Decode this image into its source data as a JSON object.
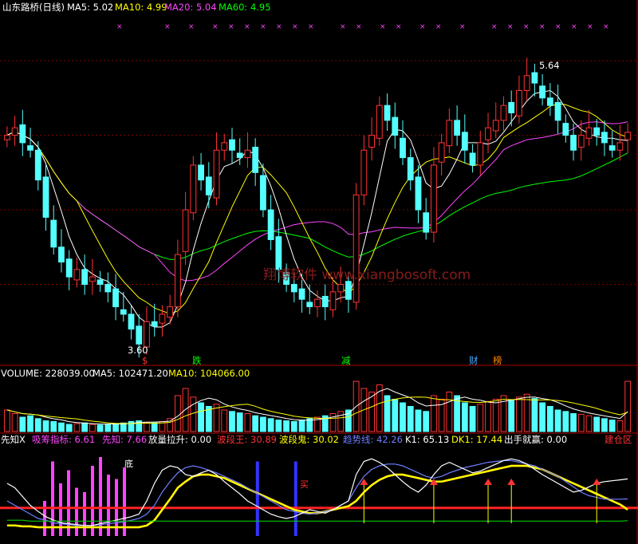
{
  "header": {
    "title": "山东路桥(日线)",
    "ma": [
      {
        "label": "MA5: 5.02",
        "color": "#ffffff"
      },
      {
        "label": "MA10: 4.99",
        "color": "#ffff00"
      },
      {
        "label": "MA20: 5.04",
        "color": "#ff44ff"
      },
      {
        "label": "MA60: 4.95",
        "color": "#00ff00"
      }
    ]
  },
  "volume_header": [
    {
      "label": "VOLUME: 228039.00",
      "color": "#ffffff"
    },
    {
      "label": "MA5: 102471.20",
      "color": "#ffffff"
    },
    {
      "label": "MA10: 104066.00",
      "color": "#ffff00"
    }
  ],
  "indicator_header": [
    {
      "label": "先知X",
      "color": "#ffffff"
    },
    {
      "label": "吸筹指标: 6.61",
      "color": "#ff44ff"
    },
    {
      "label": "先知: 7.66",
      "color": "#ff44ff"
    },
    {
      "label": "放量拉升: 0.00",
      "color": "#ffffff"
    },
    {
      "label": "波段王: 30.89",
      "color": "#ff3333"
    },
    {
      "label": "波段鬼: 30.02",
      "color": "#ffff00"
    },
    {
      "label": "趋势线: 42.26",
      "color": "#6f7fff"
    },
    {
      "label": "K1: 65.13",
      "color": "#ffffff"
    },
    {
      "label": "DK1: 17.44",
      "color": "#ffff00"
    },
    {
      "label": "出手就赢: 0.00",
      "color": "#ffffff"
    },
    {
      "label": "建仓区",
      "color": "#ff3333"
    }
  ],
  "annotations": {
    "high_label": "5.64",
    "low_label": "3.60",
    "watermark": "翔博软件 www.xiangbosoft.com",
    "signals": [
      {
        "text": "跌",
        "color": "#00ff00"
      },
      {
        "text": "减",
        "color": "#00ff00"
      },
      {
        "text": "财",
        "color": "#44aaff"
      },
      {
        "text": "榜",
        "color": "#ff8800"
      },
      {
        "text": "$",
        "color": "#ff3333"
      }
    ],
    "buy_marker": "买",
    "low_marker": "底"
  },
  "colors": {
    "up": "#ff3333",
    "down": "#54ffff",
    "ma5": "#ffffff",
    "ma10": "#ffff00",
    "ma20": "#ff44ff",
    "ma60": "#00ff00",
    "axis": "#b00000"
  },
  "chart_data": [
    {
      "type": "candlestick",
      "title": "山东路桥(日线)",
      "ylim": [
        3.5,
        5.8
      ],
      "high": 5.64,
      "low": 3.6,
      "close": [
        5.0,
        5.05,
        4.95,
        4.9,
        4.7,
        4.45,
        4.25,
        4.15,
        4.05,
        4.1,
        4.0,
        4.05,
        4.0,
        3.95,
        3.85,
        3.8,
        3.7,
        3.6,
        3.75,
        3.72,
        3.8,
        3.85,
        4.2,
        4.5,
        4.8,
        4.7,
        4.6,
        4.9,
        4.95,
        4.9,
        4.85,
        4.9,
        4.75,
        4.5,
        4.3,
        4.1,
        4.0,
        3.95,
        3.9,
        3.85,
        3.9,
        3.85,
        3.95,
        4.0,
        3.9,
        4.6,
        4.9,
        5.0,
        5.2,
        5.1,
        5.0,
        4.85,
        4.7,
        4.5,
        4.35,
        4.8,
        4.95,
        5.1,
        5.0,
        4.9,
        4.8,
        4.95,
        5.05,
        5.1,
        5.2,
        5.15,
        5.3,
        5.4,
        5.35,
        5.25,
        5.2,
        5.1,
        5.0,
        4.9,
        5.0,
        5.05,
        5.0,
        4.95,
        4.9,
        4.95,
        5.02
      ],
      "ma5": 5.02,
      "ma10": 4.99,
      "ma20": 5.04,
      "ma60": 4.95
    },
    {
      "type": "bar",
      "title": "VOLUME",
      "values": [
        30,
        25,
        20,
        22,
        18,
        15,
        14,
        12,
        10,
        11,
        12,
        10,
        9,
        10,
        11,
        12,
        14,
        15,
        13,
        12,
        14,
        18,
        50,
        60,
        48,
        40,
        35,
        38,
        30,
        28,
        26,
        25,
        22,
        20,
        18,
        16,
        15,
        14,
        16,
        18,
        20,
        22,
        25,
        28,
        30,
        70,
        60,
        55,
        65,
        50,
        45,
        40,
        35,
        30,
        28,
        50,
        45,
        55,
        50,
        40,
        35,
        38,
        42,
        45,
        50,
        44,
        48,
        52,
        46,
        40,
        35,
        30,
        28,
        25,
        24,
        22,
        20,
        18,
        16,
        15,
        70
      ],
      "volume": 228039.0,
      "ma5": 102471.2,
      "ma10": 104066.0
    },
    {
      "type": "line",
      "title": "先知X",
      "series": [
        {
          "name": "波段王",
          "values": [
            12,
            12,
            11,
            11,
            10,
            10,
            10,
            10,
            10,
            10,
            10,
            10,
            10,
            10,
            10,
            10,
            10,
            10,
            12,
            18,
            30,
            42,
            55,
            62,
            68,
            70,
            70,
            68,
            66,
            62,
            58,
            54,
            50,
            46,
            42,
            38,
            34,
            30,
            28,
            26,
            26,
            28,
            30,
            32,
            34,
            40,
            50,
            58,
            64,
            68,
            70,
            70,
            68,
            66,
            64,
            62,
            62,
            64,
            66,
            68,
            70,
            72,
            74,
            76,
            78,
            80,
            80,
            80,
            78,
            76,
            72,
            68,
            64,
            60,
            56,
            52,
            48,
            44,
            40,
            36,
            30.89
          ]
        },
        {
          "name": "波段鬼",
          "values": [
            12,
            12,
            11,
            11,
            10,
            10,
            10,
            10,
            10,
            10,
            10,
            10,
            10,
            10,
            10,
            10,
            10,
            10,
            12,
            18,
            30,
            42,
            55,
            62,
            68,
            70,
            70,
            68,
            66,
            62,
            58,
            54,
            50,
            46,
            42,
            38,
            34,
            30,
            28,
            26,
            26,
            28,
            30,
            32,
            34,
            40,
            50,
            58,
            64,
            68,
            70,
            70,
            68,
            66,
            64,
            62,
            62,
            64,
            66,
            68,
            70,
            72,
            74,
            76,
            78,
            80,
            80,
            80,
            78,
            76,
            72,
            68,
            64,
            60,
            56,
            52,
            48,
            44,
            40,
            36,
            30.02
          ]
        },
        {
          "name": "趋势线",
          "values": [
            40,
            35,
            30,
            25,
            20,
            18,
            15,
            14,
            13,
            12,
            12,
            12,
            13,
            14,
            15,
            16,
            18,
            20,
            25,
            35,
            50,
            62,
            72,
            78,
            80,
            78,
            75,
            72,
            68,
            64,
            60,
            55,
            50,
            45,
            40,
            35,
            30,
            28,
            26,
            25,
            26,
            28,
            30,
            35,
            40,
            55,
            68,
            76,
            80,
            82,
            82,
            80,
            76,
            72,
            68,
            66,
            68,
            72,
            75,
            78,
            80,
            82,
            84,
            85,
            86,
            86,
            84,
            82,
            80,
            76,
            72,
            68,
            62,
            56,
            50,
            46,
            44,
            42,
            42,
            42,
            42.26
          ]
        },
        {
          "name": "K1",
          "values": [
            60,
            55,
            45,
            35,
            28,
            22,
            18,
            15,
            14,
            13,
            12,
            12,
            14,
            16,
            18,
            20,
            22,
            25,
            40,
            60,
            75,
            80,
            78,
            70,
            68,
            72,
            75,
            70,
            62,
            55,
            48,
            40,
            35,
            30,
            25,
            22,
            20,
            22,
            26,
            30,
            28,
            26,
            30,
            35,
            40,
            70,
            85,
            88,
            84,
            78,
            70,
            62,
            55,
            50,
            58,
            70,
            80,
            84,
            80,
            76,
            72,
            74,
            78,
            82,
            86,
            88,
            86,
            82,
            76,
            70,
            65,
            60,
            55,
            50,
            52,
            56,
            60,
            62,
            63,
            64,
            65.13
          ]
        },
        {
          "name": "DK1",
          "values": [
            18,
            18,
            18,
            17,
            17,
            17,
            17,
            17,
            17,
            17,
            17,
            17,
            17,
            17,
            17,
            17,
            17,
            17,
            17,
            17,
            17,
            17,
            17,
            17,
            17,
            17,
            17,
            17,
            17,
            17,
            17,
            17,
            17,
            17,
            17,
            17,
            17,
            17,
            17,
            17,
            17,
            17,
            17,
            17,
            17,
            17,
            17,
            17,
            17,
            17,
            17,
            17,
            17,
            17,
            17,
            17,
            17,
            17,
            17,
            17,
            17,
            17,
            17,
            17,
            17,
            17,
            17,
            17,
            17,
            17,
            17,
            17,
            17,
            17,
            17,
            17,
            17,
            17,
            17,
            17,
            17.44
          ]
        }
      ],
      "values": {
        "吸筹指标": 6.61,
        "先知": 7.66,
        "放量拉升": 0.0,
        "波段王": 30.89,
        "波段鬼": 30.02,
        "趋势线": 42.26,
        "K1": 65.13,
        "DK1": 17.44,
        "出手就赢": 0.0
      }
    }
  ]
}
